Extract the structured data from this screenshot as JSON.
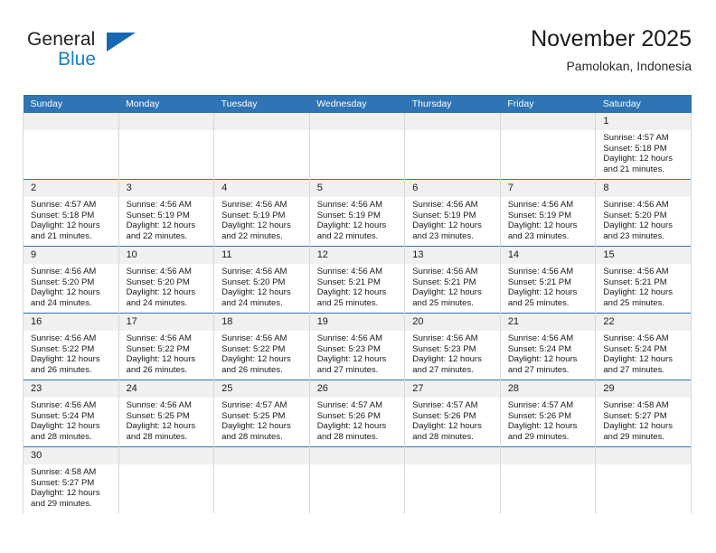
{
  "brand": {
    "name_part1": "General",
    "name_part2": "Blue",
    "triangle_icon": "triangle-right-icon",
    "accent_color": "#1668b0"
  },
  "header": {
    "title": "November 2025",
    "subtitle": "Pamolokan, Indonesia"
  },
  "theme": {
    "header_blue": "#2f74b5",
    "daynum_gray": "#f0f0f0",
    "grid_border": "#d8d8d8",
    "text": "#1a1a1a"
  },
  "weekdays": [
    "Sunday",
    "Monday",
    "Tuesday",
    "Wednesday",
    "Thursday",
    "Friday",
    "Saturday"
  ],
  "labels": {
    "sunrise_prefix": "Sunrise:",
    "sunset_prefix": "Sunset:",
    "daylight_prefix": "Daylight:"
  },
  "weeks": [
    [
      {
        "day": "",
        "empty": true
      },
      {
        "day": "",
        "empty": true
      },
      {
        "day": "",
        "empty": true
      },
      {
        "day": "",
        "empty": true
      },
      {
        "day": "",
        "empty": true
      },
      {
        "day": "",
        "empty": true
      },
      {
        "day": "1",
        "sunrise": "Sunrise: 4:57 AM",
        "sunset": "Sunset: 5:18 PM",
        "daylight_line1": "Daylight: 12 hours",
        "daylight_line2": "and 21 minutes."
      }
    ],
    [
      {
        "day": "2",
        "sunrise": "Sunrise: 4:57 AM",
        "sunset": "Sunset: 5:18 PM",
        "daylight_line1": "Daylight: 12 hours",
        "daylight_line2": "and 21 minutes."
      },
      {
        "day": "3",
        "sunrise": "Sunrise: 4:56 AM",
        "sunset": "Sunset: 5:19 PM",
        "daylight_line1": "Daylight: 12 hours",
        "daylight_line2": "and 22 minutes."
      },
      {
        "day": "4",
        "sunrise": "Sunrise: 4:56 AM",
        "sunset": "Sunset: 5:19 PM",
        "daylight_line1": "Daylight: 12 hours",
        "daylight_line2": "and 22 minutes."
      },
      {
        "day": "5",
        "sunrise": "Sunrise: 4:56 AM",
        "sunset": "Sunset: 5:19 PM",
        "daylight_line1": "Daylight: 12 hours",
        "daylight_line2": "and 22 minutes."
      },
      {
        "day": "6",
        "sunrise": "Sunrise: 4:56 AM",
        "sunset": "Sunset: 5:19 PM",
        "daylight_line1": "Daylight: 12 hours",
        "daylight_line2": "and 23 minutes."
      },
      {
        "day": "7",
        "sunrise": "Sunrise: 4:56 AM",
        "sunset": "Sunset: 5:19 PM",
        "daylight_line1": "Daylight: 12 hours",
        "daylight_line2": "and 23 minutes."
      },
      {
        "day": "8",
        "sunrise": "Sunrise: 4:56 AM",
        "sunset": "Sunset: 5:20 PM",
        "daylight_line1": "Daylight: 12 hours",
        "daylight_line2": "and 23 minutes."
      }
    ],
    [
      {
        "day": "9",
        "sunrise": "Sunrise: 4:56 AM",
        "sunset": "Sunset: 5:20 PM",
        "daylight_line1": "Daylight: 12 hours",
        "daylight_line2": "and 24 minutes."
      },
      {
        "day": "10",
        "sunrise": "Sunrise: 4:56 AM",
        "sunset": "Sunset: 5:20 PM",
        "daylight_line1": "Daylight: 12 hours",
        "daylight_line2": "and 24 minutes."
      },
      {
        "day": "11",
        "sunrise": "Sunrise: 4:56 AM",
        "sunset": "Sunset: 5:20 PM",
        "daylight_line1": "Daylight: 12 hours",
        "daylight_line2": "and 24 minutes."
      },
      {
        "day": "12",
        "sunrise": "Sunrise: 4:56 AM",
        "sunset": "Sunset: 5:21 PM",
        "daylight_line1": "Daylight: 12 hours",
        "daylight_line2": "and 25 minutes."
      },
      {
        "day": "13",
        "sunrise": "Sunrise: 4:56 AM",
        "sunset": "Sunset: 5:21 PM",
        "daylight_line1": "Daylight: 12 hours",
        "daylight_line2": "and 25 minutes."
      },
      {
        "day": "14",
        "sunrise": "Sunrise: 4:56 AM",
        "sunset": "Sunset: 5:21 PM",
        "daylight_line1": "Daylight: 12 hours",
        "daylight_line2": "and 25 minutes."
      },
      {
        "day": "15",
        "sunrise": "Sunrise: 4:56 AM",
        "sunset": "Sunset: 5:21 PM",
        "daylight_line1": "Daylight: 12 hours",
        "daylight_line2": "and 25 minutes."
      }
    ],
    [
      {
        "day": "16",
        "sunrise": "Sunrise: 4:56 AM",
        "sunset": "Sunset: 5:22 PM",
        "daylight_line1": "Daylight: 12 hours",
        "daylight_line2": "and 26 minutes."
      },
      {
        "day": "17",
        "sunrise": "Sunrise: 4:56 AM",
        "sunset": "Sunset: 5:22 PM",
        "daylight_line1": "Daylight: 12 hours",
        "daylight_line2": "and 26 minutes."
      },
      {
        "day": "18",
        "sunrise": "Sunrise: 4:56 AM",
        "sunset": "Sunset: 5:22 PM",
        "daylight_line1": "Daylight: 12 hours",
        "daylight_line2": "and 26 minutes."
      },
      {
        "day": "19",
        "sunrise": "Sunrise: 4:56 AM",
        "sunset": "Sunset: 5:23 PM",
        "daylight_line1": "Daylight: 12 hours",
        "daylight_line2": "and 27 minutes."
      },
      {
        "day": "20",
        "sunrise": "Sunrise: 4:56 AM",
        "sunset": "Sunset: 5:23 PM",
        "daylight_line1": "Daylight: 12 hours",
        "daylight_line2": "and 27 minutes."
      },
      {
        "day": "21",
        "sunrise": "Sunrise: 4:56 AM",
        "sunset": "Sunset: 5:24 PM",
        "daylight_line1": "Daylight: 12 hours",
        "daylight_line2": "and 27 minutes."
      },
      {
        "day": "22",
        "sunrise": "Sunrise: 4:56 AM",
        "sunset": "Sunset: 5:24 PM",
        "daylight_line1": "Daylight: 12 hours",
        "daylight_line2": "and 27 minutes."
      }
    ],
    [
      {
        "day": "23",
        "sunrise": "Sunrise: 4:56 AM",
        "sunset": "Sunset: 5:24 PM",
        "daylight_line1": "Daylight: 12 hours",
        "daylight_line2": "and 28 minutes."
      },
      {
        "day": "24",
        "sunrise": "Sunrise: 4:56 AM",
        "sunset": "Sunset: 5:25 PM",
        "daylight_line1": "Daylight: 12 hours",
        "daylight_line2": "and 28 minutes."
      },
      {
        "day": "25",
        "sunrise": "Sunrise: 4:57 AM",
        "sunset": "Sunset: 5:25 PM",
        "daylight_line1": "Daylight: 12 hours",
        "daylight_line2": "and 28 minutes."
      },
      {
        "day": "26",
        "sunrise": "Sunrise: 4:57 AM",
        "sunset": "Sunset: 5:26 PM",
        "daylight_line1": "Daylight: 12 hours",
        "daylight_line2": "and 28 minutes."
      },
      {
        "day": "27",
        "sunrise": "Sunrise: 4:57 AM",
        "sunset": "Sunset: 5:26 PM",
        "daylight_line1": "Daylight: 12 hours",
        "daylight_line2": "and 28 minutes."
      },
      {
        "day": "28",
        "sunrise": "Sunrise: 4:57 AM",
        "sunset": "Sunset: 5:26 PM",
        "daylight_line1": "Daylight: 12 hours",
        "daylight_line2": "and 29 minutes."
      },
      {
        "day": "29",
        "sunrise": "Sunrise: 4:58 AM",
        "sunset": "Sunset: 5:27 PM",
        "daylight_line1": "Daylight: 12 hours",
        "daylight_line2": "and 29 minutes."
      }
    ],
    [
      {
        "day": "30",
        "sunrise": "Sunrise: 4:58 AM",
        "sunset": "Sunset: 5:27 PM",
        "daylight_line1": "Daylight: 12 hours",
        "daylight_line2": "and 29 minutes."
      },
      {
        "day": "",
        "empty": true
      },
      {
        "day": "",
        "empty": true
      },
      {
        "day": "",
        "empty": true
      },
      {
        "day": "",
        "empty": true
      },
      {
        "day": "",
        "empty": true
      },
      {
        "day": "",
        "empty": true
      }
    ]
  ]
}
